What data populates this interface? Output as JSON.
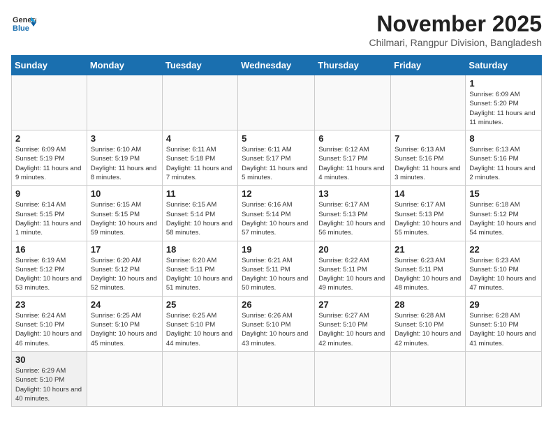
{
  "logo": {
    "text_general": "General",
    "text_blue": "Blue"
  },
  "title": "November 2025",
  "subtitle": "Chilmari, Rangpur Division, Bangladesh",
  "days_of_week": [
    "Sunday",
    "Monday",
    "Tuesday",
    "Wednesday",
    "Thursday",
    "Friday",
    "Saturday"
  ],
  "weeks": [
    [
      {
        "day": "",
        "info": ""
      },
      {
        "day": "",
        "info": ""
      },
      {
        "day": "",
        "info": ""
      },
      {
        "day": "",
        "info": ""
      },
      {
        "day": "",
        "info": ""
      },
      {
        "day": "",
        "info": ""
      },
      {
        "day": "1",
        "info": "Sunrise: 6:09 AM\nSunset: 5:20 PM\nDaylight: 11 hours and 11 minutes."
      }
    ],
    [
      {
        "day": "2",
        "info": "Sunrise: 6:09 AM\nSunset: 5:19 PM\nDaylight: 11 hours and 9 minutes."
      },
      {
        "day": "3",
        "info": "Sunrise: 6:10 AM\nSunset: 5:19 PM\nDaylight: 11 hours and 8 minutes."
      },
      {
        "day": "4",
        "info": "Sunrise: 6:11 AM\nSunset: 5:18 PM\nDaylight: 11 hours and 7 minutes."
      },
      {
        "day": "5",
        "info": "Sunrise: 6:11 AM\nSunset: 5:17 PM\nDaylight: 11 hours and 5 minutes."
      },
      {
        "day": "6",
        "info": "Sunrise: 6:12 AM\nSunset: 5:17 PM\nDaylight: 11 hours and 4 minutes."
      },
      {
        "day": "7",
        "info": "Sunrise: 6:13 AM\nSunset: 5:16 PM\nDaylight: 11 hours and 3 minutes."
      },
      {
        "day": "8",
        "info": "Sunrise: 6:13 AM\nSunset: 5:16 PM\nDaylight: 11 hours and 2 minutes."
      }
    ],
    [
      {
        "day": "9",
        "info": "Sunrise: 6:14 AM\nSunset: 5:15 PM\nDaylight: 11 hours and 1 minute."
      },
      {
        "day": "10",
        "info": "Sunrise: 6:15 AM\nSunset: 5:15 PM\nDaylight: 10 hours and 59 minutes."
      },
      {
        "day": "11",
        "info": "Sunrise: 6:15 AM\nSunset: 5:14 PM\nDaylight: 10 hours and 58 minutes."
      },
      {
        "day": "12",
        "info": "Sunrise: 6:16 AM\nSunset: 5:14 PM\nDaylight: 10 hours and 57 minutes."
      },
      {
        "day": "13",
        "info": "Sunrise: 6:17 AM\nSunset: 5:13 PM\nDaylight: 10 hours and 56 minutes."
      },
      {
        "day": "14",
        "info": "Sunrise: 6:17 AM\nSunset: 5:13 PM\nDaylight: 10 hours and 55 minutes."
      },
      {
        "day": "15",
        "info": "Sunrise: 6:18 AM\nSunset: 5:12 PM\nDaylight: 10 hours and 54 minutes."
      }
    ],
    [
      {
        "day": "16",
        "info": "Sunrise: 6:19 AM\nSunset: 5:12 PM\nDaylight: 10 hours and 53 minutes."
      },
      {
        "day": "17",
        "info": "Sunrise: 6:20 AM\nSunset: 5:12 PM\nDaylight: 10 hours and 52 minutes."
      },
      {
        "day": "18",
        "info": "Sunrise: 6:20 AM\nSunset: 5:11 PM\nDaylight: 10 hours and 51 minutes."
      },
      {
        "day": "19",
        "info": "Sunrise: 6:21 AM\nSunset: 5:11 PM\nDaylight: 10 hours and 50 minutes."
      },
      {
        "day": "20",
        "info": "Sunrise: 6:22 AM\nSunset: 5:11 PM\nDaylight: 10 hours and 49 minutes."
      },
      {
        "day": "21",
        "info": "Sunrise: 6:23 AM\nSunset: 5:11 PM\nDaylight: 10 hours and 48 minutes."
      },
      {
        "day": "22",
        "info": "Sunrise: 6:23 AM\nSunset: 5:10 PM\nDaylight: 10 hours and 47 minutes."
      }
    ],
    [
      {
        "day": "23",
        "info": "Sunrise: 6:24 AM\nSunset: 5:10 PM\nDaylight: 10 hours and 46 minutes."
      },
      {
        "day": "24",
        "info": "Sunrise: 6:25 AM\nSunset: 5:10 PM\nDaylight: 10 hours and 45 minutes."
      },
      {
        "day": "25",
        "info": "Sunrise: 6:25 AM\nSunset: 5:10 PM\nDaylight: 10 hours and 44 minutes."
      },
      {
        "day": "26",
        "info": "Sunrise: 6:26 AM\nSunset: 5:10 PM\nDaylight: 10 hours and 43 minutes."
      },
      {
        "day": "27",
        "info": "Sunrise: 6:27 AM\nSunset: 5:10 PM\nDaylight: 10 hours and 42 minutes."
      },
      {
        "day": "28",
        "info": "Sunrise: 6:28 AM\nSunset: 5:10 PM\nDaylight: 10 hours and 42 minutes."
      },
      {
        "day": "29",
        "info": "Sunrise: 6:28 AM\nSunset: 5:10 PM\nDaylight: 10 hours and 41 minutes."
      }
    ],
    [
      {
        "day": "30",
        "info": "Sunrise: 6:29 AM\nSunset: 5:10 PM\nDaylight: 10 hours and 40 minutes."
      },
      {
        "day": "",
        "info": ""
      },
      {
        "day": "",
        "info": ""
      },
      {
        "day": "",
        "info": ""
      },
      {
        "day": "",
        "info": ""
      },
      {
        "day": "",
        "info": ""
      },
      {
        "day": "",
        "info": ""
      }
    ]
  ]
}
